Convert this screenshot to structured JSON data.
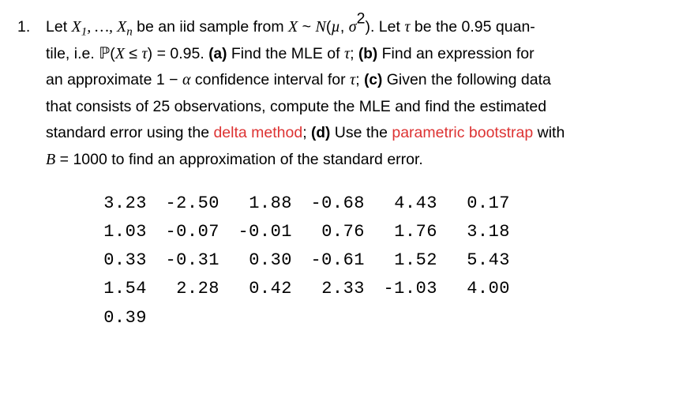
{
  "problem": {
    "number": "1.",
    "intro_prefix": "Let ",
    "sample": {
      "X": "X",
      "sub1": "1",
      "ellipsis": ", …, ",
      "subn": "n"
    },
    "intro_mid1": " be an iid sample from ",
    "dist": {
      "X": "X",
      "tilde": " ~ ",
      "N": "N",
      "open": "(",
      "mu": "µ",
      "comma": ", ",
      "sigma": "σ",
      "sq": "2",
      "close": ")"
    },
    "intro_mid2": ". Let ",
    "tau": "τ",
    "intro_mid3": " be the 0.95 quan-",
    "line2a": "tile, i.e. ",
    "prob_expr": {
      "P": "ℙ",
      "open": "(",
      "X": "X",
      "le": " ≤ ",
      "tau": "τ",
      "close": ")",
      "eq": " = 0.95"
    },
    "line2b": ". ",
    "a_label": "(a)",
    "a_text1": " Find the MLE of ",
    "a_tau": "τ",
    "a_text2": "; ",
    "b_label": "(b)",
    "b_text": " Find an expression for",
    "line3a": "an approximate ",
    "one_minus_alpha": {
      "one": "1",
      "minus": " − ",
      "alpha": "α"
    },
    "line3b": " confidence interval for ",
    "line3_tau": "τ",
    "line3c": "; ",
    "c_label": "(c)",
    "c_text": " Given the following data",
    "line4": "that consists of 25 observations, compute the MLE and find the estimated",
    "line5a": "standard error using the ",
    "delta": "delta method",
    "line5b": "; ",
    "d_label": "(d)",
    "d_text1": " Use the ",
    "pboot": "parametric bootstrap",
    "d_text2": " with",
    "line6a": "",
    "B_expr": {
      "B": "B",
      "eq": " = ",
      "val": "1000"
    },
    "line6b": " to find an approximation of the standard error."
  },
  "data_values": [
    [
      "3.23",
      "-2.50",
      "1.88",
      "-0.68",
      "4.43",
      "0.17"
    ],
    [
      "1.03",
      "-0.07",
      "-0.01",
      "0.76",
      "1.76",
      "3.18"
    ],
    [
      "0.33",
      "-0.31",
      "0.30",
      "-0.61",
      "1.52",
      "5.43"
    ],
    [
      "1.54",
      "2.28",
      "0.42",
      "2.33",
      "-1.03",
      "4.00"
    ],
    [
      "0.39"
    ]
  ]
}
